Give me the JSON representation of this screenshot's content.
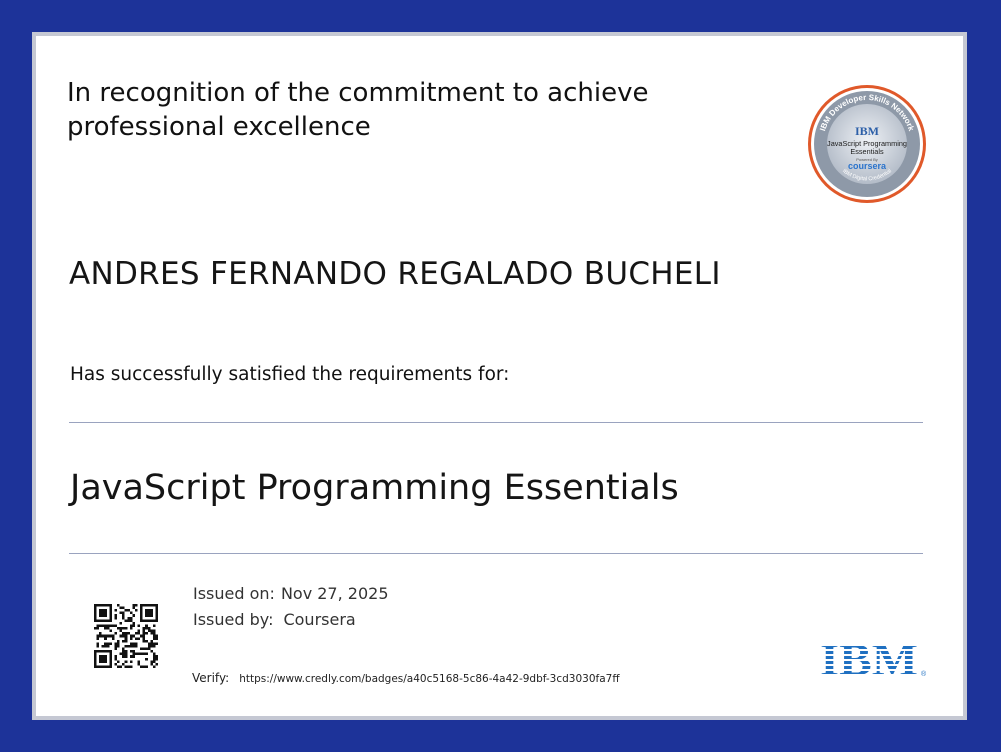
{
  "certificate": {
    "recognition_text": "In recognition of the commitment to achieve professional excellence",
    "recipient_name": "ANDRES FERNANDO REGALADO BUCHELI",
    "satisfied_text": "Has successfully satisfied the requirements for:",
    "course_title": "JavaScript Programming Essentials",
    "issued_on_label": "Issued on:",
    "issued_on_value": "Nov 27, 2025",
    "issued_by_label": "Issued by:",
    "issued_by_value": "Coursera",
    "verify_label": "Verify:",
    "verify_url": "https://www.credly.com/badges/a40c5168-5c86-4a42-9dbf-3cd3030fa7ff"
  },
  "badge": {
    "ring_text": "IBM Developer Skills Network",
    "logo_text": "IBM",
    "line1": "JavaScript Programming",
    "line2": "Essentials",
    "powered_by": "Powered By",
    "brand": "coursera",
    "bottom_text": "IBM Digital Credential"
  },
  "logo": {
    "text": "IBM",
    "registered": "®"
  },
  "colors": {
    "outer_border": "#1d3399",
    "frame": "#c5c8d3",
    "badge_ring": "#e0592a",
    "ibm_blue": "#1f70c1"
  },
  "icons": {
    "qr": "qr-code-icon"
  }
}
